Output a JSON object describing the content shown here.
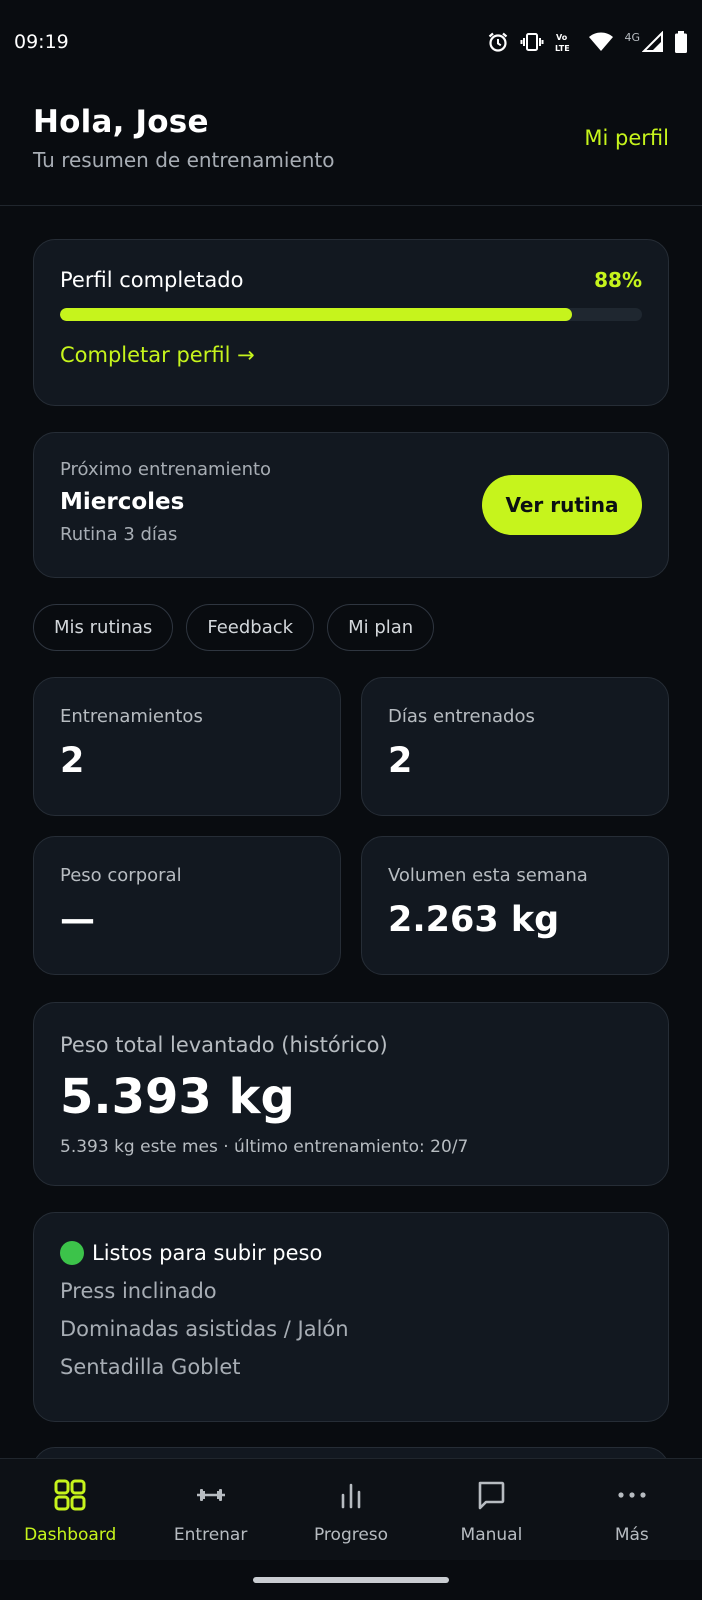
{
  "status_bar": {
    "time": "09:19",
    "network_label": "4G"
  },
  "header": {
    "greeting": "Hola, Jose",
    "subtitle": "Tu resumen de entrenamiento",
    "profile_link": "Mi perfil"
  },
  "profile_progress": {
    "label": "Perfil completado",
    "percent_text": "88%",
    "percent": 88,
    "action": "Completar perfil →"
  },
  "next_workout": {
    "caption": "Próximo entrenamiento",
    "day": "Miercoles",
    "routine": "Rutina 3 días",
    "button": "Ver rutina"
  },
  "chips": [
    "Mis rutinas",
    "Feedback",
    "Mi plan"
  ],
  "stats": [
    {
      "label": "Entrenamientos",
      "value": "2"
    },
    {
      "label": "Días entrenados",
      "value": "2"
    },
    {
      "label": "Peso corporal",
      "value": "—"
    },
    {
      "label": "Volumen esta semana",
      "value": "2.263 kg"
    }
  ],
  "total_lifted": {
    "label": "Peso total levantado (histórico)",
    "value": "5.393 kg",
    "sub": "5.393 kg este mes · último entrenamiento: 20/7"
  },
  "ready_to_increase": {
    "title": "Listos para subir peso",
    "items": [
      "Press inclinado",
      "Dominadas asistidas / Jalón",
      "Sentadilla Goblet"
    ]
  },
  "bottom_nav": [
    {
      "label": "Dashboard",
      "icon": "dashboard-grid-icon",
      "active": true
    },
    {
      "label": "Entrenar",
      "icon": "dumbbell-icon",
      "active": false
    },
    {
      "label": "Progreso",
      "icon": "bar-chart-icon",
      "active": false
    },
    {
      "label": "Manual",
      "icon": "message-square-icon",
      "active": false
    },
    {
      "label": "Más",
      "icon": "more-dots-icon",
      "active": false
    }
  ],
  "colors": {
    "accent": "#c6f41c",
    "background": "#090c10",
    "card": "#121820",
    "muted_text": "#a7adb4",
    "status_green": "#3cc34a"
  }
}
